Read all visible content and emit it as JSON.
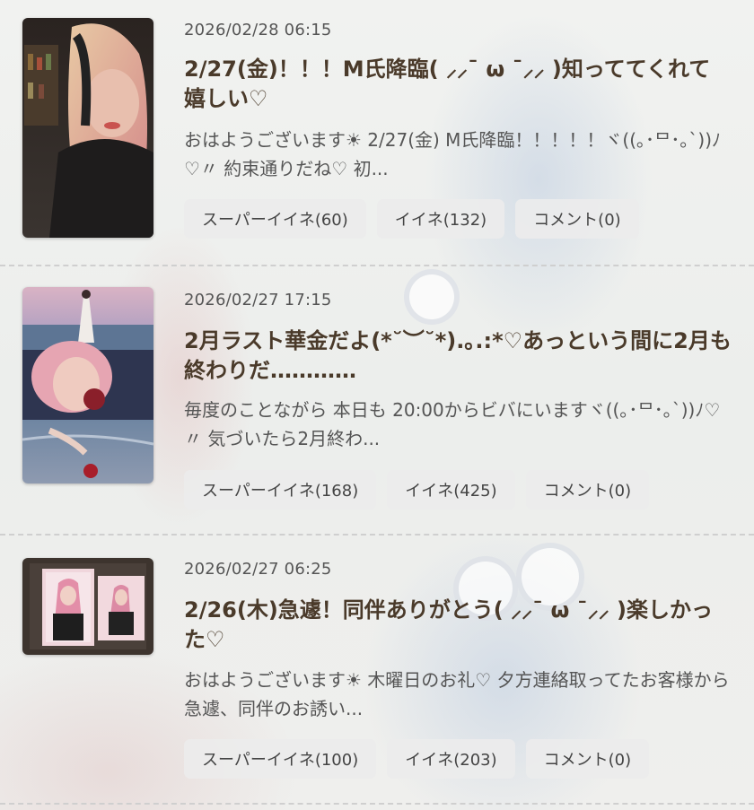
{
  "colors": {
    "title": "#4a3a2a",
    "text": "#555555",
    "button_bg": "#ececec",
    "divider": "#cfcfcf"
  },
  "posts": [
    {
      "date": "2026/02/28 06:15",
      "title": "2/27(金)！！！M氏降臨( ⸝⸝¯ ω ¯⸝⸝ )知っててくれて嬉しい♡",
      "excerpt": "おはようございます☀ 2/27(金) M氏降臨！！！！！ヾ((｡･ᄆ･｡`))ﾉ♡〃 約束通りだね♡ 初...",
      "super_like": "スーパーイイネ(60)",
      "like": "イイネ(132)",
      "comment": "コメント(0)"
    },
    {
      "date": "2026/02/27 17:15",
      "title": "2月ラスト華金だよ(*˘︶˘*).｡.:*♡あっという間に2月も終わりだ…………",
      "excerpt": " 毎度のことながら 本日も 20:00からビバにいますヾ((｡･ᄆ･｡`))ﾉ♡〃 気づいたら2月終わ...",
      "super_like": "スーパーイイネ(168)",
      "like": "イイネ(425)",
      "comment": "コメント(0)"
    },
    {
      "date": "2026/02/27 06:25",
      "title": "2/26(木)急遽！同伴ありがとう( ⸝⸝¯ ω ¯⸝⸝ )楽しかった♡",
      "excerpt": "おはようございます☀ 木曜日のお礼♡ 夕方連絡取ってたお客様から急遽、同伴のお誘い...",
      "super_like": "スーパーイイネ(100)",
      "like": "イイネ(203)",
      "comment": "コメント(0)"
    }
  ]
}
